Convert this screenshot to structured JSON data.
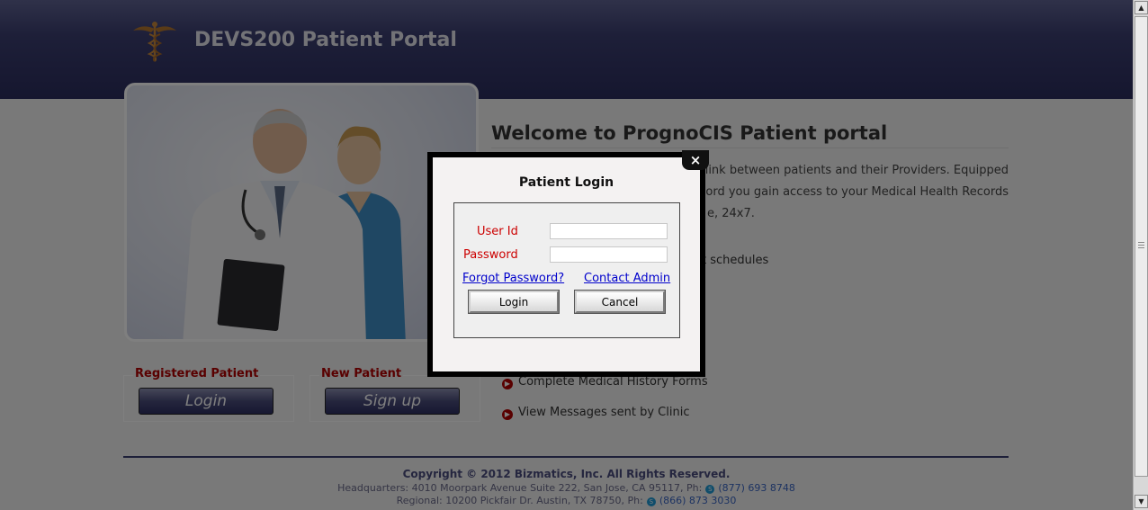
{
  "header": {
    "title": "DEVS200 Patient Portal",
    "logo_icon": "caduceus-icon"
  },
  "registered": {
    "label": "Registered Patient",
    "button": "Login"
  },
  "new_patient": {
    "label": "New Patient",
    "button": "Sign up"
  },
  "main": {
    "heading": "Welcome to PrognoCIS Patient portal",
    "intro_lines": [
      "link between patients and their Providers. Equipped",
      "ord you gain access to your Medical Health Records",
      "e, 24x7."
    ],
    "partial_item": "t schedules",
    "features": [
      "Complete Medical History Forms",
      "View Messages sent by Clinic"
    ]
  },
  "footer": {
    "copyright": "Copyright © 2012 Bizmatics, Inc. All Rights Reserved.",
    "hq_label": "Headquarters: 4010 Moorpark Avenue Suite 222, San Jose, CA 95117, Ph:",
    "hq_phone": "(877) 693 8748",
    "regional_label": "Regional: 10200 Pickfair Dr. Austin, TX 78750, Ph:",
    "regional_phone": "(866) 873 3030"
  },
  "modal": {
    "title": "Patient Login",
    "close": "×",
    "user_label": "User Id",
    "user_value": "",
    "password_label": "Password",
    "password_value": "",
    "forgot": "Forgot Password?",
    "contact": "Contact Admin",
    "login": "Login",
    "cancel": "Cancel"
  },
  "colors": {
    "header": "#2b2d5e",
    "accent_red": "#b20000",
    "link": "#0000cc"
  }
}
